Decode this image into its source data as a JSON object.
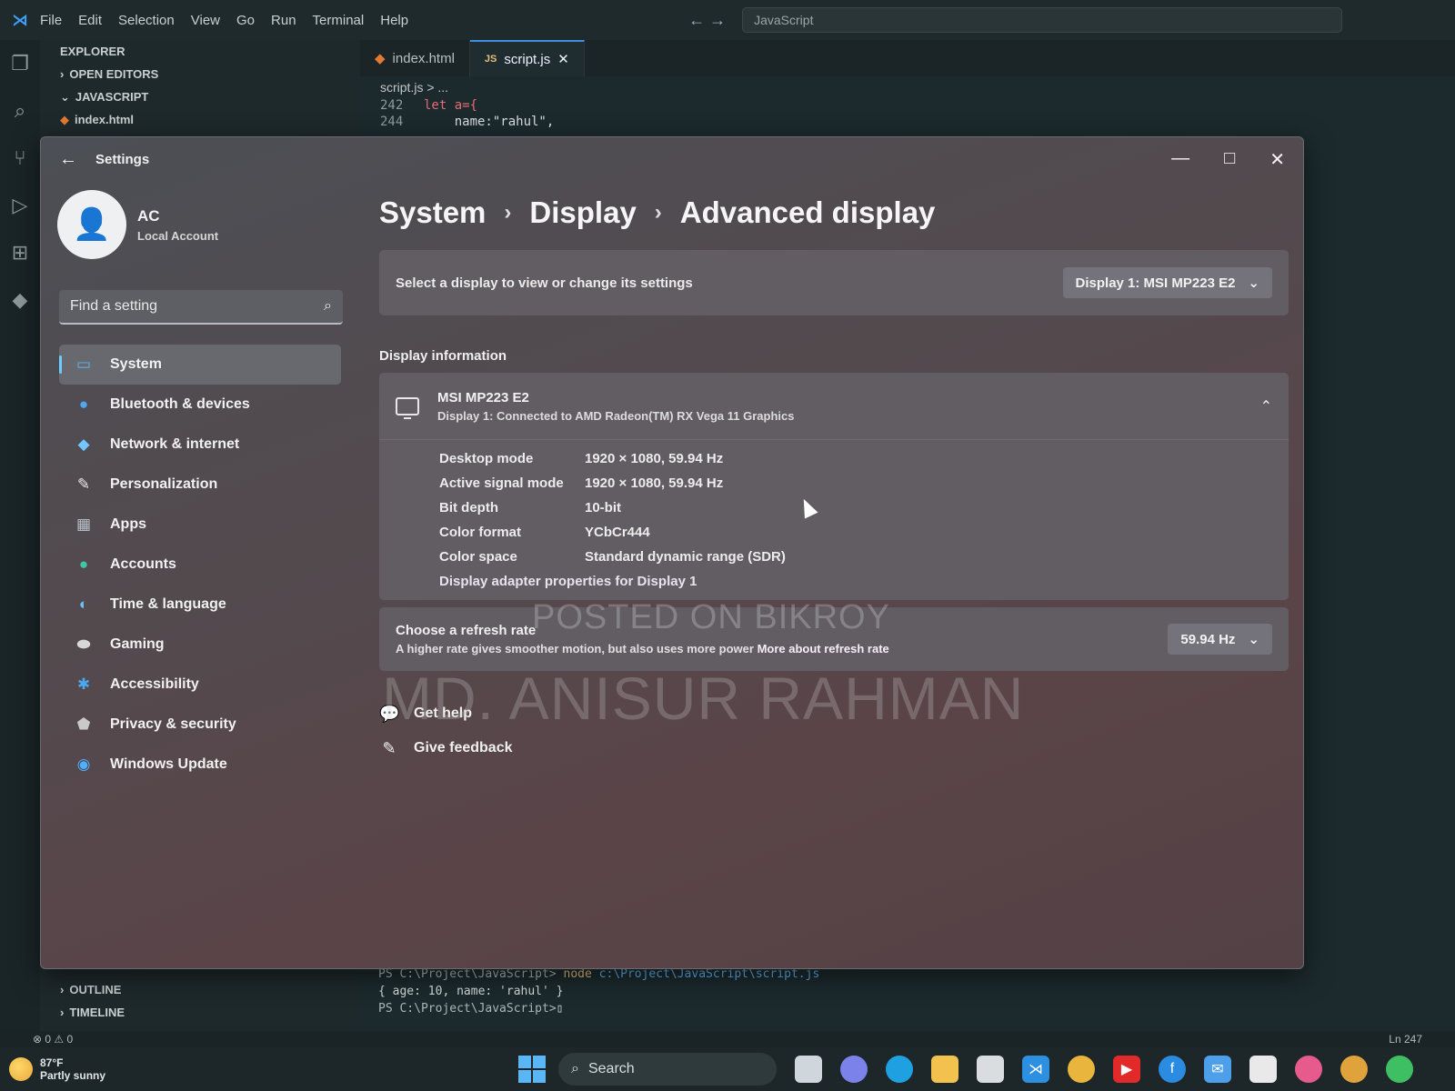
{
  "vscode": {
    "menu": [
      "File",
      "Edit",
      "Selection",
      "View",
      "Go",
      "Run",
      "Terminal",
      "Help"
    ],
    "command_center": "JavaScript",
    "explorer": {
      "title": "EXPLORER",
      "open_editors": "OPEN EDITORS",
      "folder": "JAVASCRIPT",
      "file": "index.html"
    },
    "tabs": [
      {
        "label": "index.html",
        "icon": "html-icon"
      },
      {
        "label": "script.js",
        "icon": "js-icon",
        "close": "✕"
      }
    ],
    "breadcrumb": "script.js > ...",
    "code": [
      {
        "ln": "242",
        "text": "let a={"
      },
      {
        "ln": "244",
        "text": "    name:\"rahul\","
      }
    ],
    "terminal": [
      {
        "path": "PS C:\\Project\\JavaScript>",
        "cmd": "node",
        "arg": "c:\\Project\\JavaScript\\script.js"
      },
      {
        "out": "{ age: 10, name: 'rahul' }"
      },
      {
        "path": "PS C:\\Project\\JavaScript>",
        "cursor": "▯"
      }
    ],
    "bottom_sections": [
      "OUTLINE",
      "TIMELINE"
    ],
    "status_left": "⊗ 0 ⚠ 0",
    "status_right": "Ln 247"
  },
  "settings": {
    "window_title": "Settings",
    "profile_initials": "AC",
    "profile_sub": "Local Account",
    "search_placeholder": "Find a setting",
    "nav": [
      {
        "label": "System",
        "icon": "monitor-icon",
        "color": "#5fb5ef"
      },
      {
        "label": "Bluetooth & devices",
        "icon": "bluetooth-icon",
        "color": "#4ea7f0"
      },
      {
        "label": "Network & internet",
        "icon": "wifi-icon",
        "color": "#73c6ff"
      },
      {
        "label": "Personalization",
        "icon": "brush-icon",
        "color": "#e7e7e7"
      },
      {
        "label": "Apps",
        "icon": "apps-icon",
        "color": "#b9c2cc"
      },
      {
        "label": "Accounts",
        "icon": "person-icon",
        "color": "#3fc7a8"
      },
      {
        "label": "Time & language",
        "icon": "globe-icon",
        "color": "#6cc0f2"
      },
      {
        "label": "Gaming",
        "icon": "gamepad-icon",
        "color": "#d8d8d8"
      },
      {
        "label": "Accessibility",
        "icon": "accessibility-icon",
        "color": "#4aa8f0"
      },
      {
        "label": "Privacy & security",
        "icon": "shield-icon",
        "color": "#c9c9c9"
      },
      {
        "label": "Windows Update",
        "icon": "update-icon",
        "color": "#4fb0ff"
      }
    ],
    "breadcrumb": [
      "System",
      "Display",
      "Advanced display"
    ],
    "select_label": "Select a display to view or change its settings",
    "select_value": "Display 1: MSI MP223 E2",
    "section_title": "Display information",
    "monitor_name": "MSI MP223 E2",
    "monitor_sub": "Display 1: Connected to AMD Radeon(TM) RX Vega 11 Graphics",
    "info": [
      {
        "label": "Desktop mode",
        "value": "1920 × 1080, 59.94 Hz"
      },
      {
        "label": "Active signal mode",
        "value": "1920 × 1080, 59.94 Hz"
      },
      {
        "label": "Bit depth",
        "value": "10-bit"
      },
      {
        "label": "Color format",
        "value": "YCbCr444"
      },
      {
        "label": "Color space",
        "value": "Standard dynamic range (SDR)"
      }
    ],
    "adapter_link": "Display adapter properties for Display 1",
    "refresh_title": "Choose a refresh rate",
    "refresh_desc": "A higher rate gives smoother motion, but also uses more power",
    "refresh_link": "More about refresh rate",
    "refresh_value": "59.94 Hz",
    "get_help": "Get help",
    "give_feedback": "Give feedback"
  },
  "watermark": {
    "line1": "POSTED ON BIKROY",
    "line2": "MD. ANISUR RAHMAN"
  },
  "taskbar": {
    "weather_temp": "87°F",
    "weather_desc": "Partly sunny",
    "search": "Search"
  }
}
